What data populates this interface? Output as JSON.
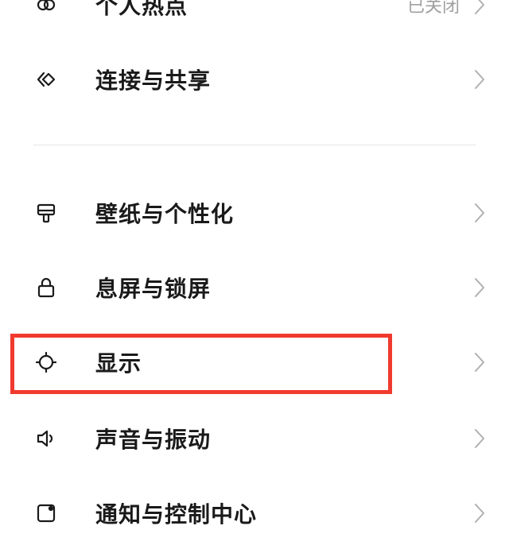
{
  "settings": {
    "items": [
      {
        "label": "个人热点",
        "value": "已关闭",
        "icon": "hotspot-icon"
      },
      {
        "label": "连接与共享",
        "icon": "connection-sharing-icon"
      },
      {
        "label": "壁纸与个性化",
        "icon": "paint-brush-icon"
      },
      {
        "label": "息屏与锁屏",
        "icon": "lock-icon"
      },
      {
        "label": "显示",
        "icon": "brightness-icon"
      },
      {
        "label": "声音与振动",
        "icon": "speaker-icon"
      },
      {
        "label": "通知与控制中心",
        "icon": "notification-icon"
      }
    ]
  },
  "colors": {
    "highlight": "#f03a2e",
    "text": "#1a1a1a",
    "secondary_text": "#a0a0a0",
    "divider": "#e6e6e6",
    "chevron": "#b0b0b0"
  }
}
